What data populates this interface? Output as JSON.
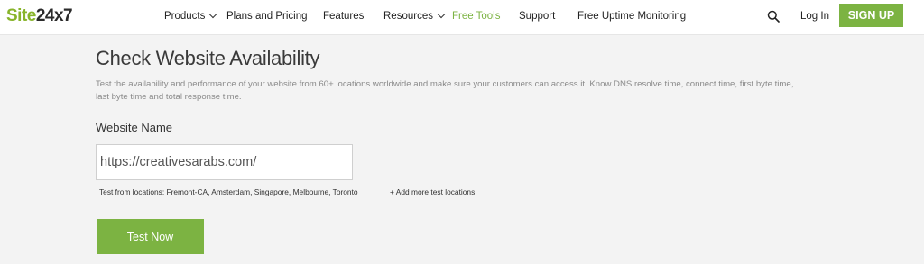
{
  "header": {
    "logo": {
      "part1": "Site",
      "part2": "24x7"
    },
    "nav": [
      {
        "label": "Products",
        "has_dropdown": true
      },
      {
        "label": "Plans and Pricing",
        "has_dropdown": false
      },
      {
        "label": "Features",
        "has_dropdown": false
      },
      {
        "label": "Resources",
        "has_dropdown": true
      },
      {
        "label": "Free Tools",
        "has_dropdown": false,
        "active": true
      },
      {
        "label": "Support",
        "has_dropdown": false
      },
      {
        "label": "Free Uptime Monitoring",
        "has_dropdown": false
      }
    ],
    "search_icon": "search-icon",
    "login_label": "Log In",
    "signup_label": "SIGN UP"
  },
  "main": {
    "title": "Check Website Availability",
    "description": "Test the availability and performance of your website from 60+ locations worldwide and make sure your customers can access it. Know DNS resolve time, connect time, first byte time, last byte time and total response time.",
    "field_label": "Website Name",
    "website_value": "https://creativesarabs.com/",
    "locations_text": "Test from locations: Fremont-CA, Amsterdam, Singapore, Melbourne, Toronto",
    "add_locations_label": "+ Add more test locations",
    "test_button_label": "Test Now"
  },
  "colors": {
    "brand_green": "#7cb342",
    "background": "#f3f3f3"
  }
}
